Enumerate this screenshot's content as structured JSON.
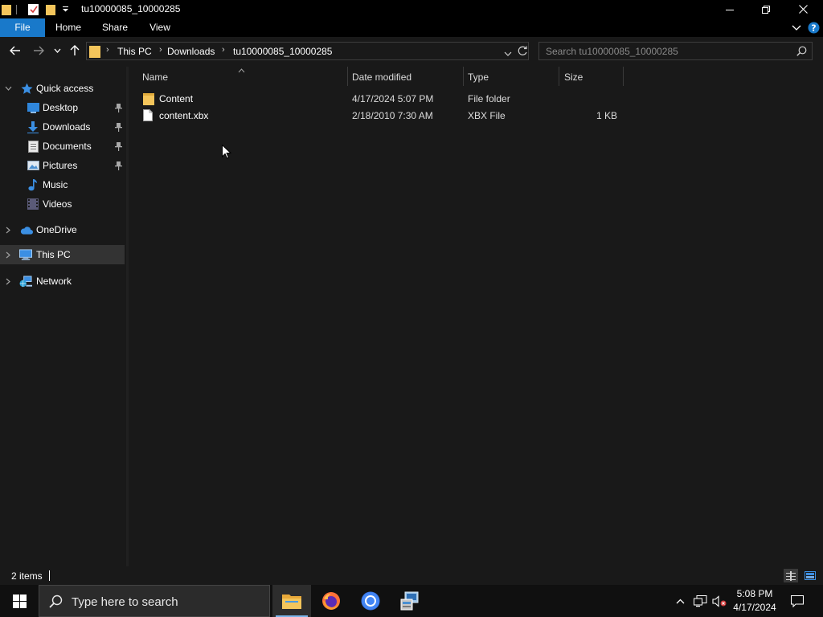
{
  "window": {
    "title": "tu10000085_10000285",
    "minimize": "─",
    "restore": "❐",
    "close": "✕"
  },
  "ribbon": {
    "tabs": [
      "File",
      "Home",
      "Share",
      "View"
    ],
    "expand_icon": "chevron-down-icon",
    "help_icon": "help-icon"
  },
  "address": {
    "crumbs": [
      "This PC",
      "Downloads",
      "tu10000085_10000285"
    ],
    "search_placeholder": "Search tu10000085_10000285"
  },
  "nav": {
    "quick_access": "Quick access",
    "items": [
      {
        "label": "Desktop",
        "icon": "desktop-icon",
        "pinned": true
      },
      {
        "label": "Downloads",
        "icon": "downloads-icon",
        "pinned": true
      },
      {
        "label": "Documents",
        "icon": "documents-icon",
        "pinned": true
      },
      {
        "label": "Pictures",
        "icon": "pictures-icon",
        "pinned": true
      },
      {
        "label": "Music",
        "icon": "music-icon",
        "pinned": false
      },
      {
        "label": "Videos",
        "icon": "videos-icon",
        "pinned": false
      }
    ],
    "onedrive": "OneDrive",
    "this_pc": "This PC",
    "network": "Network",
    "selected": "This PC"
  },
  "columns": {
    "name": "Name",
    "date": "Date modified",
    "type": "Type",
    "size": "Size"
  },
  "files": [
    {
      "name": "Content",
      "date": "4/17/2024 5:07 PM",
      "type": "File folder",
      "size": "",
      "icon": "folder-icon"
    },
    {
      "name": "content.xbx",
      "date": "2/18/2010 7:30 AM",
      "type": "XBX File",
      "size": "1 KB",
      "icon": "file-icon"
    }
  ],
  "status": {
    "items_count": "2 items"
  },
  "taskbar": {
    "search_placeholder": "Type here to search",
    "time": "5:08 PM",
    "date": "4/17/2024"
  },
  "colors": {
    "accent": "#1979ca",
    "folder": "#f4c55b",
    "background": "#191919"
  }
}
